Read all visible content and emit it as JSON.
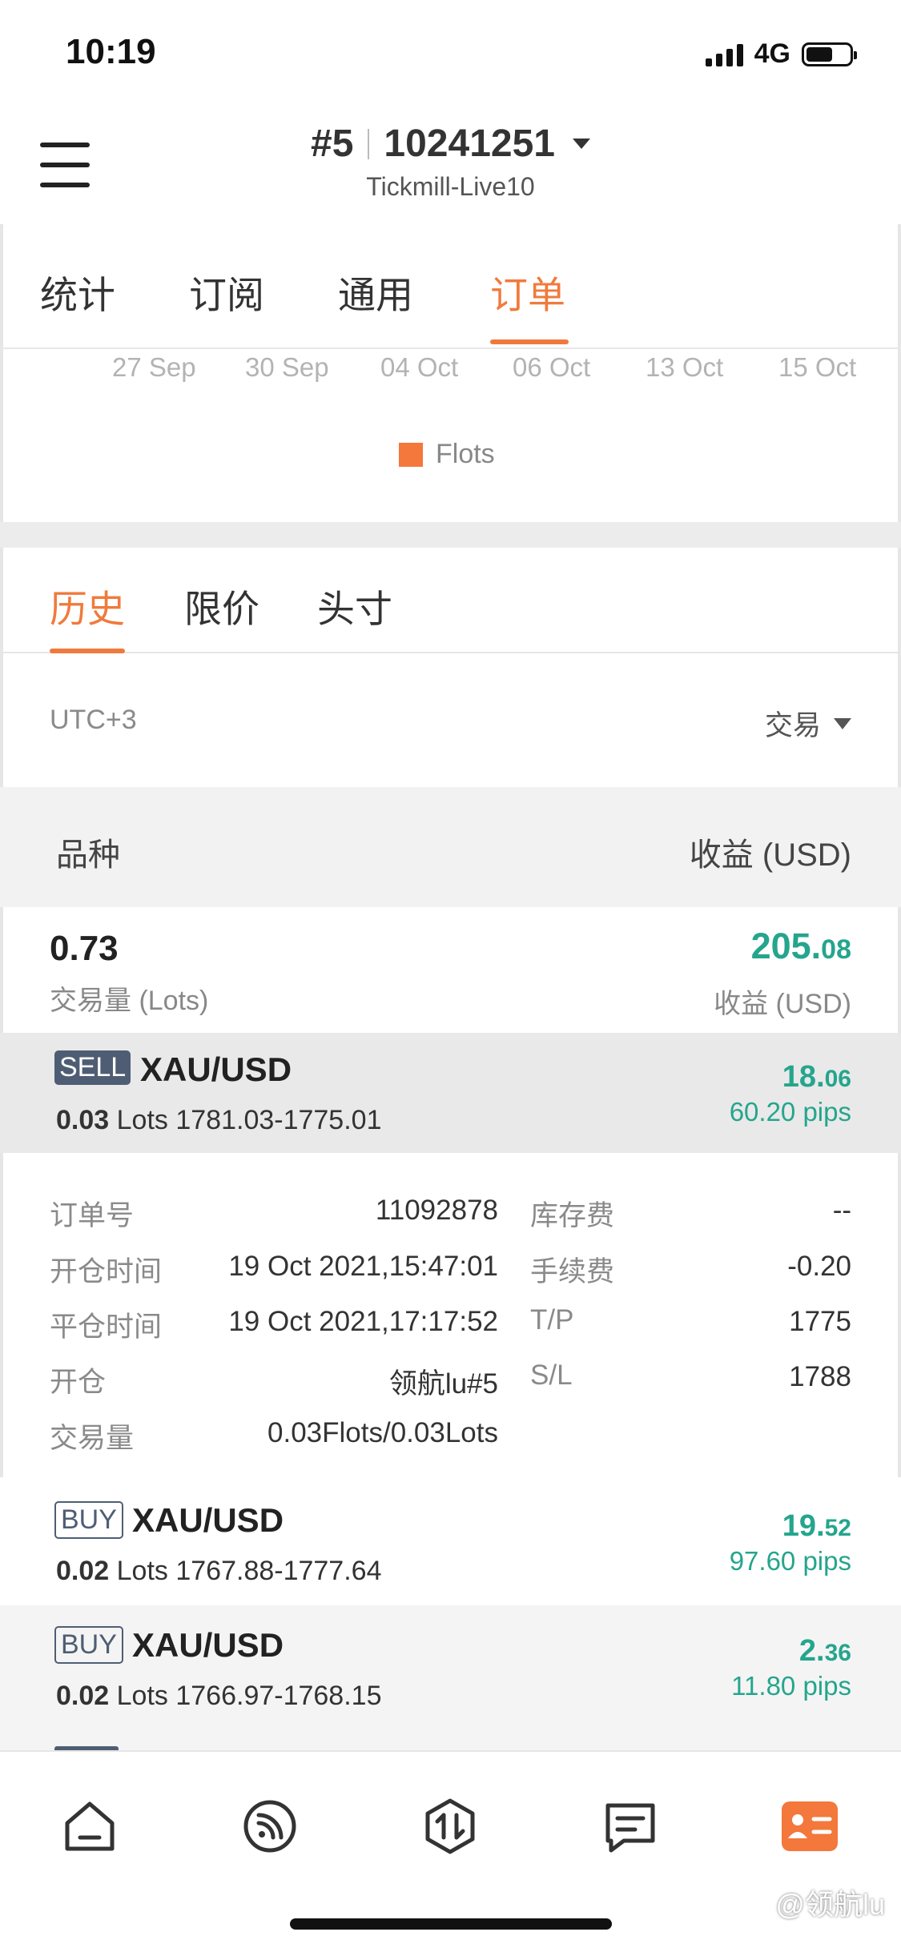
{
  "status_bar": {
    "time": "10:19",
    "network": "4G",
    "battery_level": 0.62
  },
  "header": {
    "account_prefix": "#5",
    "account_number": "10241251",
    "server": "Tickmill-Live10"
  },
  "main_tabs": [
    {
      "label": "统计",
      "active": false
    },
    {
      "label": "订阅",
      "active": false
    },
    {
      "label": "通用",
      "active": false
    },
    {
      "label": "订单",
      "active": true
    }
  ],
  "chart_data": {
    "type": "bar",
    "categories": [
      "27 Sep",
      "30 Sep",
      "04 Oct",
      "06 Oct",
      "13 Oct",
      "15 Oct"
    ],
    "series": [
      {
        "name": "Flots",
        "color": "#f4773b"
      }
    ]
  },
  "sub_tabs": [
    {
      "label": "历史",
      "active": true
    },
    {
      "label": "限价",
      "active": false
    },
    {
      "label": "头寸",
      "active": false
    }
  ],
  "filter": {
    "timezone": "UTC+3",
    "type_label": "交易"
  },
  "table_header": {
    "symbol": "品种",
    "profit": "收益 (USD)"
  },
  "summary": {
    "volume": "0.73",
    "volume_label": "交易量 (Lots)",
    "profit_main": "205.",
    "profit_cents": "08",
    "profit_label": "收益 (USD)"
  },
  "orders": [
    {
      "side": "SELL",
      "symbol": "XAU/USD",
      "lots": "0.03",
      "lots_unit": "Lots",
      "prices": "1781.03-1775.01",
      "profit_main": "18.",
      "profit_cents": "06",
      "pips": "60.20 pips",
      "expanded": true
    },
    {
      "side": "BUY",
      "symbol": "XAU/USD",
      "lots": "0.02",
      "lots_unit": "Lots",
      "prices": "1767.88-1777.64",
      "profit_main": "19.",
      "profit_cents": "52",
      "pips": "97.60 pips"
    },
    {
      "side": "BUY",
      "symbol": "XAU/USD",
      "lots": "0.02",
      "lots_unit": "Lots",
      "prices": "1766.97-1768.15",
      "profit_main": "2.",
      "profit_cents": "36",
      "pips": "11.80 pips"
    }
  ],
  "detail": {
    "order_no_label": "订单号",
    "order_no": "11092878",
    "open_time_label": "开仓时间",
    "open_time": "19 Oct 2021,15:47:01",
    "close_time_label": "平仓时间",
    "close_time": "19 Oct 2021,17:17:52",
    "open_label": "开仓",
    "open_source": "领航lu#5",
    "volume_label": "交易量",
    "volume": "0.03Flots/0.03Lots",
    "swap_label": "库存费",
    "swap": "--",
    "fee_label": "手续费",
    "fee": "-0.20",
    "tp_label": "T/P",
    "tp": "1775",
    "sl_label": "S/L",
    "sl": "1788"
  },
  "bottom_nav": [
    {
      "icon": "home-icon"
    },
    {
      "icon": "signal-feed-icon"
    },
    {
      "icon": "trade-swap-icon"
    },
    {
      "icon": "message-icon"
    },
    {
      "icon": "profile-card-icon",
      "active": true,
      "color": "#f4773b"
    }
  ],
  "watermark": "@领航lu"
}
